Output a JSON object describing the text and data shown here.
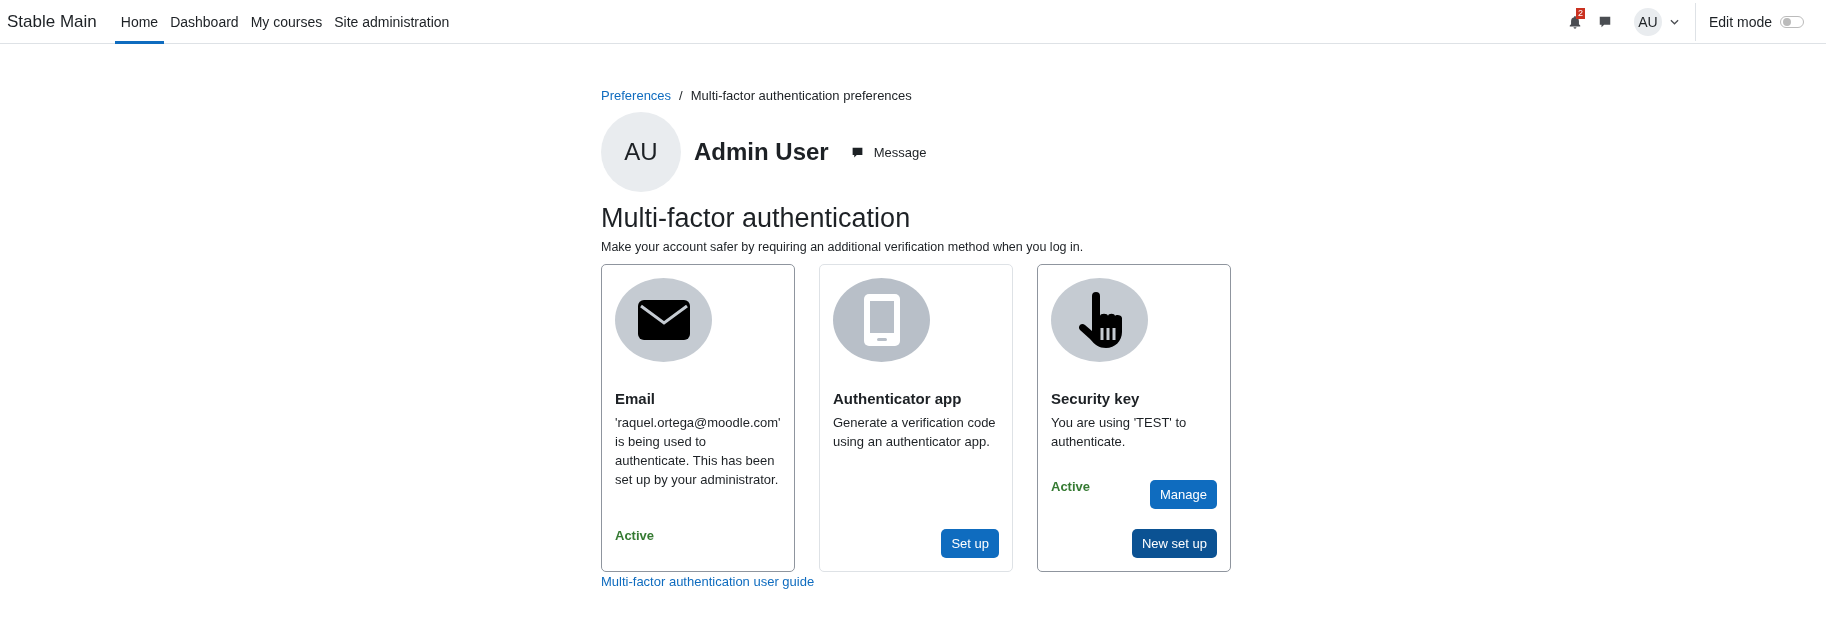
{
  "navbar": {
    "site_name": "Stable Main",
    "items": [
      {
        "label": "Home",
        "selected": true
      },
      {
        "label": "Dashboard",
        "selected": false
      },
      {
        "label": "My courses",
        "selected": false
      },
      {
        "label": "Site administration",
        "selected": false
      }
    ],
    "notification_count": "2",
    "user_initials": "AU",
    "edit_mode": {
      "label": "Edit mode",
      "on": false
    }
  },
  "breadcrumb": {
    "separator": "/",
    "items": [
      {
        "label": "Preferences",
        "link": true
      },
      {
        "label": "Multi-factor authentication preferences",
        "link": false
      }
    ]
  },
  "profile": {
    "initials": "AU",
    "name": "Admin User",
    "message_label": "Message"
  },
  "heading": "Multi-factor authentication",
  "intro": "Make your account safer by requiring an additional verification method when you log in.",
  "factors": [
    {
      "kind": "email",
      "title": "Email",
      "description": "'raquel.ortega@moodle.com' is being used to authenticate. This has been set up by your administrator.",
      "active": true,
      "status": "Active"
    },
    {
      "kind": "phone",
      "title": "Authenticator app",
      "description": "Generate a verification code using an authenticator app.",
      "active": false,
      "buttons": [
        "Set up"
      ]
    },
    {
      "kind": "hand",
      "title": "Security key",
      "description": "You are using 'TEST' to authenticate.",
      "active": true,
      "status": "Active",
      "buttons": [
        "Manage",
        "New set up"
      ]
    }
  ],
  "guide_link": "Multi-factor authentication user guide"
}
